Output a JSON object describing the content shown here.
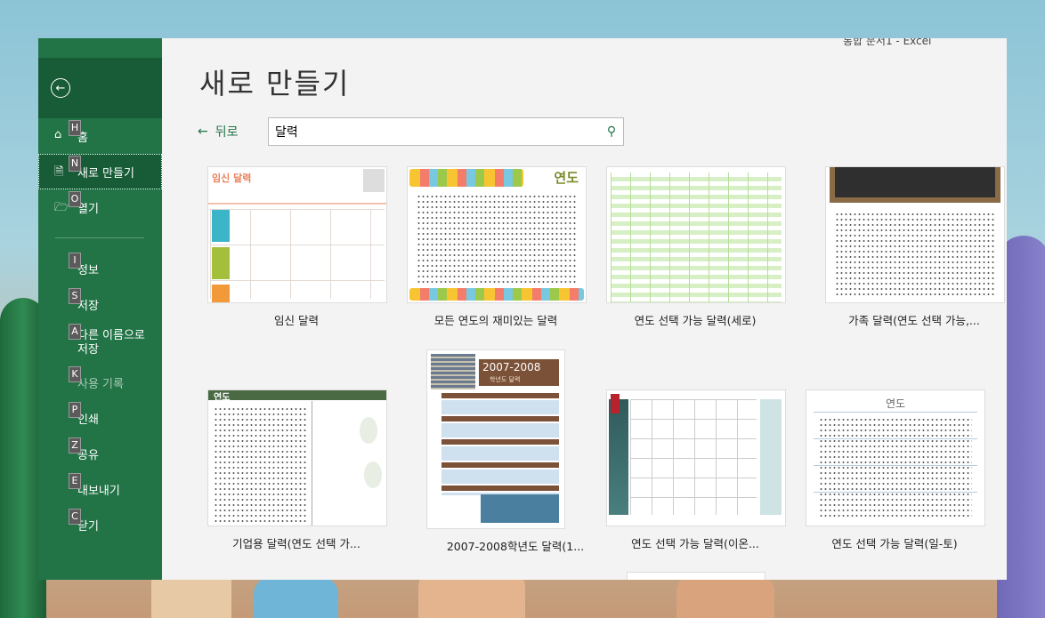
{
  "app_title": "통합 문서1 - Excel",
  "sidebar": {
    "back_icon": "back-arrow-icon",
    "items": [
      {
        "key": "H",
        "label": "홈",
        "icon": "home-icon"
      },
      {
        "key": "N",
        "label": "새로 만들기",
        "icon": "new-document-icon",
        "active": true
      },
      {
        "key": "O",
        "label": "열기",
        "icon": "open-folder-icon"
      },
      {
        "key": "I",
        "label": "정보"
      },
      {
        "key": "S",
        "label": "저장"
      },
      {
        "key": "A",
        "label": "다른 이름으로 저장"
      },
      {
        "key": "K",
        "label": "사용 기록",
        "disabled": true
      },
      {
        "key": "P",
        "label": "인쇄"
      },
      {
        "key": "Z",
        "label": "공유"
      },
      {
        "key": "E",
        "label": "내보내기"
      },
      {
        "key": "C",
        "label": "닫기"
      }
    ]
  },
  "main": {
    "title": "새로 만들기",
    "back_label": "뒤로",
    "search": {
      "value": "달력",
      "icon": "search-icon"
    },
    "templates": [
      {
        "label": "임신 달력",
        "thumb_title": "임신 달력",
        "color": "#e9815b"
      },
      {
        "label": "모든 연도의 재미있는 달력",
        "thumb_title": "연도",
        "color": "#7a8b2a"
      },
      {
        "label": "연도 선택 가능 달력(세로)",
        "color": "#9fd17a"
      },
      {
        "label": "가족 달력(연도 선택 가능,...",
        "color": "#3a3a3a"
      },
      {
        "label": "기업용 달력(연도 선택 가...",
        "thumb_title": "연도",
        "color": "#4a6a44"
      },
      {
        "label": "2007-2008학년도 달력(1...",
        "thumb_title": "2007-2008",
        "thumb_sub": "학년도 달력",
        "color": "#8a5a3a"
      },
      {
        "label": "연도 선택 가능 달력(이온...",
        "color": "#2f5a5a"
      },
      {
        "label": "연도 선택 가능 달력(일-토)",
        "thumb_title": "연도",
        "color": "#4b7fb0"
      }
    ]
  }
}
